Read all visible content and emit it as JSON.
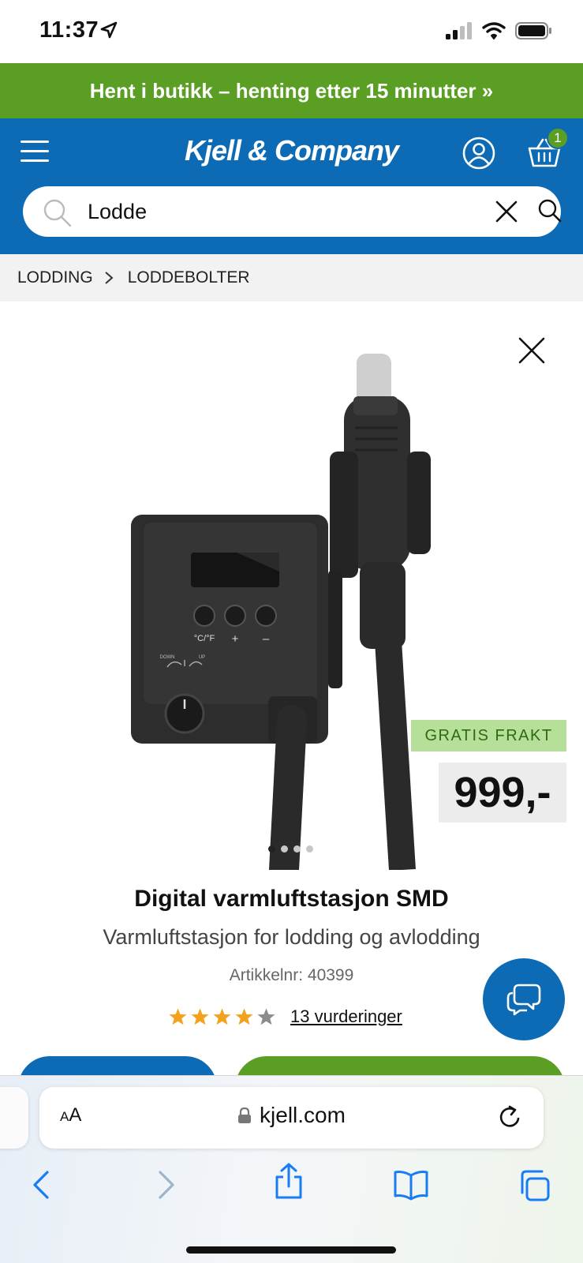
{
  "status": {
    "time": "11:37"
  },
  "promo": {
    "text": "Hent i butikk – henting etter 15 minutter »"
  },
  "header": {
    "logo": "Kjell & Company",
    "cart_count": "1"
  },
  "search": {
    "value": "Lodde"
  },
  "breadcrumb": {
    "items": [
      "LODDING",
      "LODDEBOLTER"
    ]
  },
  "product": {
    "badge": "GRATIS FRAKT",
    "price": "999,-",
    "title": "Digital varmluftstasjon SMD",
    "subtitle": "Varmluftstasjon for lodding og avlodding",
    "article": "Artikkelnr: 40399",
    "rating": 4,
    "rating_max": 5,
    "reviews": "13 vurderinger",
    "image_count": 4,
    "image_active": 0,
    "panel_labels": [
      "°C/°F",
      "+",
      "–",
      "DOWN",
      "UP"
    ]
  },
  "browser": {
    "aa_large": "A",
    "aa_small": "A",
    "url": "kjell.com"
  },
  "colors": {
    "brand_blue": "#0c6bb4",
    "brand_green": "#5a9e23",
    "badge_green": "#b6e09a",
    "star": "#f4a21c"
  }
}
